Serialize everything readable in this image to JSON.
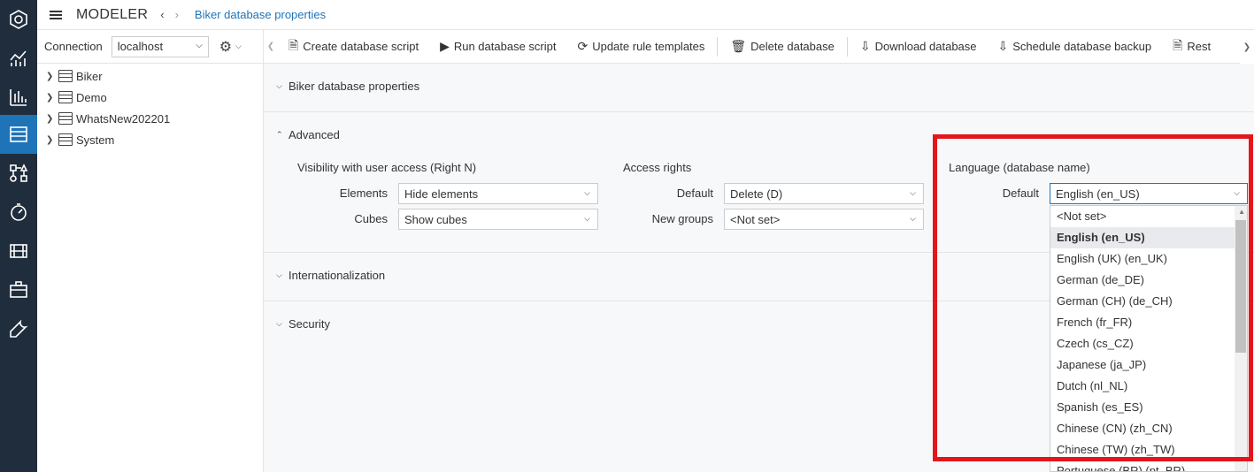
{
  "header": {
    "app_title": "MODELER",
    "back_arrow": "‹",
    "forward_arrow": "›",
    "breadcrumb": "Biker database properties"
  },
  "rail": {
    "items": [
      "hexagon-logo-icon",
      "analytics-icon",
      "reports-icon",
      "database-server-icon",
      "hierarchy-icon",
      "dashboard-gauge-icon",
      "film-icon",
      "briefcase-icon",
      "wrench-icon"
    ],
    "active_index": 3
  },
  "connection": {
    "label": "Connection",
    "value": "localhost"
  },
  "tree": {
    "items": [
      {
        "label": "Biker"
      },
      {
        "label": "Demo"
      },
      {
        "label": "WhatsNew202201"
      },
      {
        "label": "System"
      }
    ]
  },
  "toolbar": {
    "items": [
      {
        "label": "Create database script",
        "icon": "create-script-icon"
      },
      {
        "label": "Run database script",
        "icon": "play-icon"
      },
      {
        "label": "Update rule templates",
        "icon": "refresh-icon"
      },
      {
        "label": "Delete database",
        "icon": "trash-icon"
      },
      {
        "label": "Download database",
        "icon": "download-icon"
      },
      {
        "label": "Schedule database backup",
        "icon": "schedule-icon"
      },
      {
        "label": "Rest",
        "icon": "restore-icon"
      }
    ]
  },
  "sections": {
    "properties": "Biker database properties",
    "advanced": "Advanced",
    "internationalization": "Internationalization",
    "security": "Security"
  },
  "visibility": {
    "title": "Visibility with user access (Right N)",
    "elements_label": "Elements",
    "elements_value": "Hide elements",
    "cubes_label": "Cubes",
    "cubes_value": "Show cubes"
  },
  "access": {
    "title": "Access rights",
    "default_label": "Default",
    "default_value": "Delete (D)",
    "newgroups_label": "New groups",
    "newgroups_value": "<Not set>"
  },
  "language": {
    "title": "Language (database name)",
    "default_label": "Default",
    "default_value": "English (en_US)",
    "options": [
      "<Not set>",
      "English (en_US)",
      "English (UK) (en_UK)",
      "German (de_DE)",
      "German (CH) (de_CH)",
      "French (fr_FR)",
      "Czech (cs_CZ)",
      "Japanese (ja_JP)",
      "Dutch (nl_NL)",
      "Spanish (es_ES)",
      "Chinese (CN) (zh_CN)",
      "Chinese (TW) (zh_TW)",
      "Portuguese (BR) (pt_BR)"
    ],
    "selected_index": 1
  },
  "colors": {
    "rail_bg": "#1f2d3d",
    "accent": "#1f74b8",
    "highlight_border": "#e3161b"
  }
}
